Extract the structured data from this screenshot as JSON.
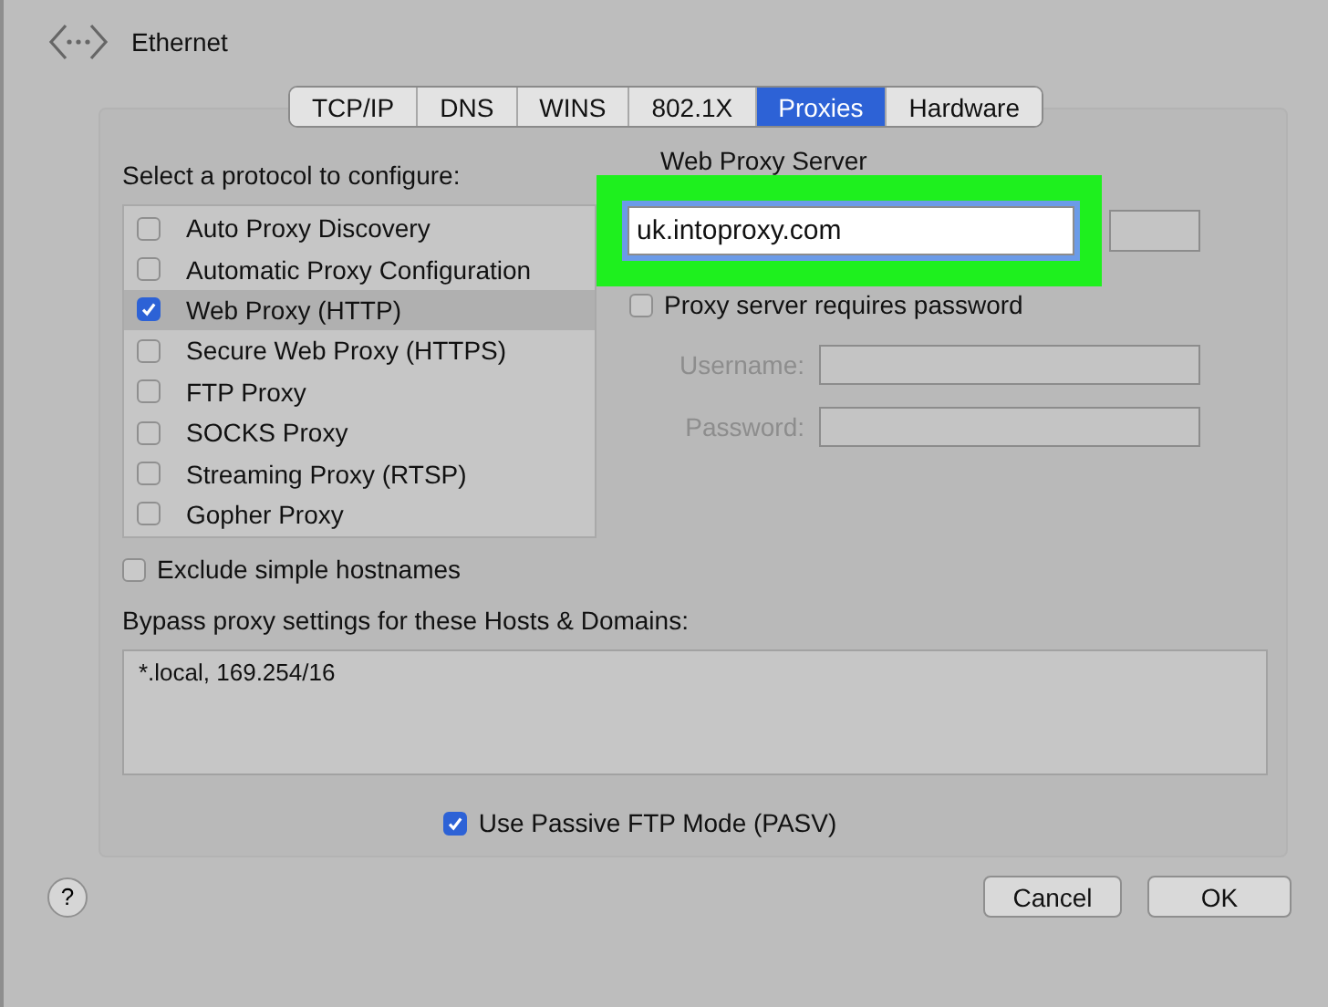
{
  "window": {
    "title": "Ethernet"
  },
  "tabs": [
    {
      "label": "TCP/IP",
      "selected": false
    },
    {
      "label": "DNS",
      "selected": false
    },
    {
      "label": "WINS",
      "selected": false
    },
    {
      "label": "802.1X",
      "selected": false
    },
    {
      "label": "Proxies",
      "selected": true
    },
    {
      "label": "Hardware",
      "selected": false
    }
  ],
  "protocols": {
    "label": "Select a protocol to configure:",
    "items": [
      {
        "label": "Auto Proxy Discovery",
        "checked": false,
        "selected": false
      },
      {
        "label": "Automatic Proxy Configuration",
        "checked": false,
        "selected": false
      },
      {
        "label": "Web Proxy (HTTP)",
        "checked": true,
        "selected": true
      },
      {
        "label": "Secure Web Proxy (HTTPS)",
        "checked": false,
        "selected": false
      },
      {
        "label": "FTP Proxy",
        "checked": false,
        "selected": false
      },
      {
        "label": "SOCKS Proxy",
        "checked": false,
        "selected": false
      },
      {
        "label": "Streaming Proxy (RTSP)",
        "checked": false,
        "selected": false
      },
      {
        "label": "Gopher Proxy",
        "checked": false,
        "selected": false
      }
    ]
  },
  "web_proxy_server": {
    "label": "Web Proxy Server",
    "value": "uk.intoproxy.com",
    "highlighted": true
  },
  "requires_password": {
    "label": "Proxy server requires password",
    "checked": false
  },
  "username": {
    "label": "Username:",
    "disabled": true
  },
  "password": {
    "label": "Password:",
    "disabled": true
  },
  "exclude_simple_hostnames": {
    "label": "Exclude simple hostnames",
    "checked": false
  },
  "bypass": {
    "label": "Bypass proxy settings for these Hosts & Domains:",
    "value": "*.local, 169.254/16"
  },
  "passive_ftp": {
    "label": "Use Passive FTP Mode (PASV)",
    "checked": true
  },
  "help_button": {
    "label": "?"
  },
  "buttons": [
    {
      "label": "Cancel"
    },
    {
      "label": "OK"
    }
  ]
}
